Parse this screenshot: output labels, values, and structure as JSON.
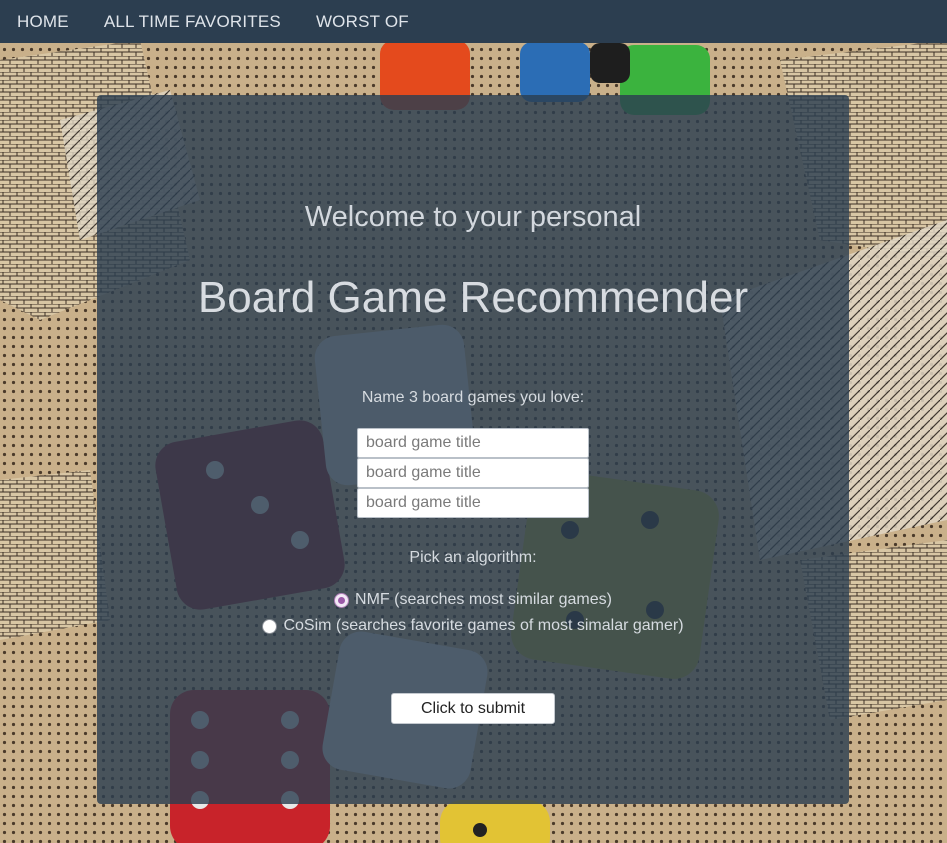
{
  "nav": {
    "home": "HOME",
    "favorites": "ALL TIME FAVORITES",
    "worst": "WORST OF"
  },
  "card": {
    "welcome": "Welcome to your personal",
    "title": "Board Game Recommender",
    "prompt": "Name 3 board games you love:",
    "inputs": [
      {
        "placeholder": "board game title",
        "value": ""
      },
      {
        "placeholder": "board game title",
        "value": ""
      },
      {
        "placeholder": "board game title",
        "value": ""
      }
    ],
    "algorithm_label": "Pick an algorithm:",
    "options": [
      {
        "label": "NMF (searches most similar games)",
        "selected": true
      },
      {
        "label": "CoSim (searches favorite games of most simalar gamer)",
        "selected": false
      }
    ],
    "submit": "Click to submit"
  },
  "colors": {
    "navbar": "#2c3e50",
    "card": "#2c3e50",
    "text": "#d6dbe0"
  },
  "icons": {
    "background": "board-game-dice-photo"
  }
}
